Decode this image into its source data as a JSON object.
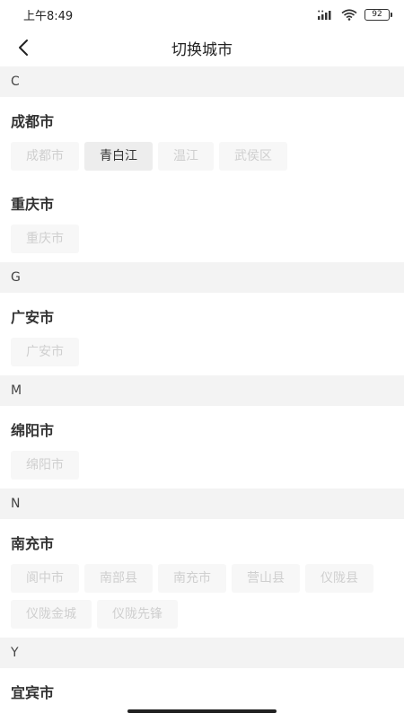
{
  "status": {
    "time": "上午8:49",
    "battery": "92"
  },
  "header": {
    "title": "切换城市"
  },
  "sections": [
    {
      "letter": "C",
      "cities": [
        {
          "name": "成都市",
          "tags": [
            "成都市",
            "青白江",
            "温江",
            "武侯区"
          ]
        },
        {
          "name": "重庆市",
          "tags": [
            "重庆市"
          ]
        }
      ]
    },
    {
      "letter": "G",
      "cities": [
        {
          "name": "广安市",
          "tags": [
            "广安市"
          ]
        }
      ]
    },
    {
      "letter": "M",
      "cities": [
        {
          "name": "绵阳市",
          "tags": [
            "绵阳市"
          ]
        }
      ]
    },
    {
      "letter": "N",
      "cities": [
        {
          "name": "南充市",
          "tags": [
            "阆中市",
            "南部县",
            "南充市",
            "营山县",
            "仪陇县",
            "仪陇金城",
            "仪陇先锋"
          ]
        }
      ]
    },
    {
      "letter": "Y",
      "cities": [
        {
          "name": "宜宾市",
          "tags": []
        }
      ]
    }
  ],
  "selected": "青白江"
}
